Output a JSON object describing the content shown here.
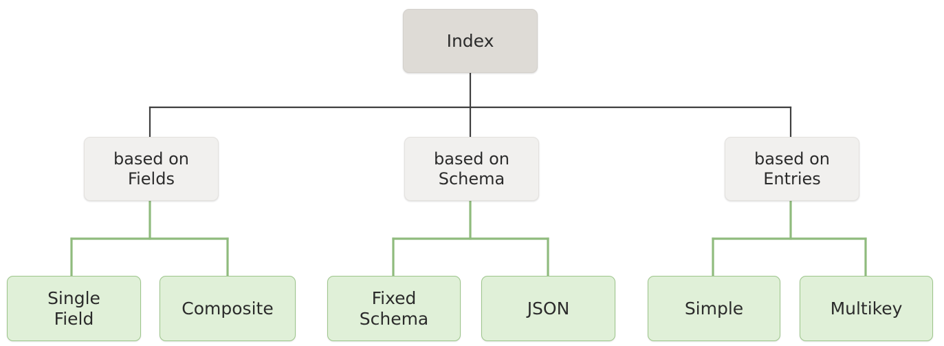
{
  "diagram": {
    "title": "Index",
    "type": "tree-hierarchy",
    "background_color": "#ffffff",
    "colors": {
      "root_fill": "#dedbd6",
      "root_border": "#d3d0cb",
      "mid_fill": "#f1f0ee",
      "mid_border": "#e3e1de",
      "leaf_fill": "#e0f0d8",
      "leaf_border": "#9cc58a",
      "edge_dark": "#3f3f3f",
      "edge_green": "#8fbb7d",
      "text": "#2b2b2b"
    },
    "levels": {
      "root": {
        "id": "index",
        "label": "Index"
      },
      "categories": [
        {
          "id": "based-on-fields",
          "label": "based on\nFields"
        },
        {
          "id": "based-on-schema",
          "label": "based on\nSchema"
        },
        {
          "id": "based-on-entries",
          "label": "based on\nEntries"
        }
      ],
      "leaves": [
        {
          "id": "single-field",
          "label": "Single\nField",
          "parent": "based-on-fields"
        },
        {
          "id": "composite",
          "label": "Composite",
          "parent": "based-on-fields"
        },
        {
          "id": "fixed-schema",
          "label": "Fixed\nSchema",
          "parent": "based-on-schema"
        },
        {
          "id": "json",
          "label": "JSON",
          "parent": "based-on-schema"
        },
        {
          "id": "simple",
          "label": "Simple",
          "parent": "based-on-entries"
        },
        {
          "id": "multikey",
          "label": "Multikey",
          "parent": "based-on-entries"
        }
      ]
    }
  }
}
